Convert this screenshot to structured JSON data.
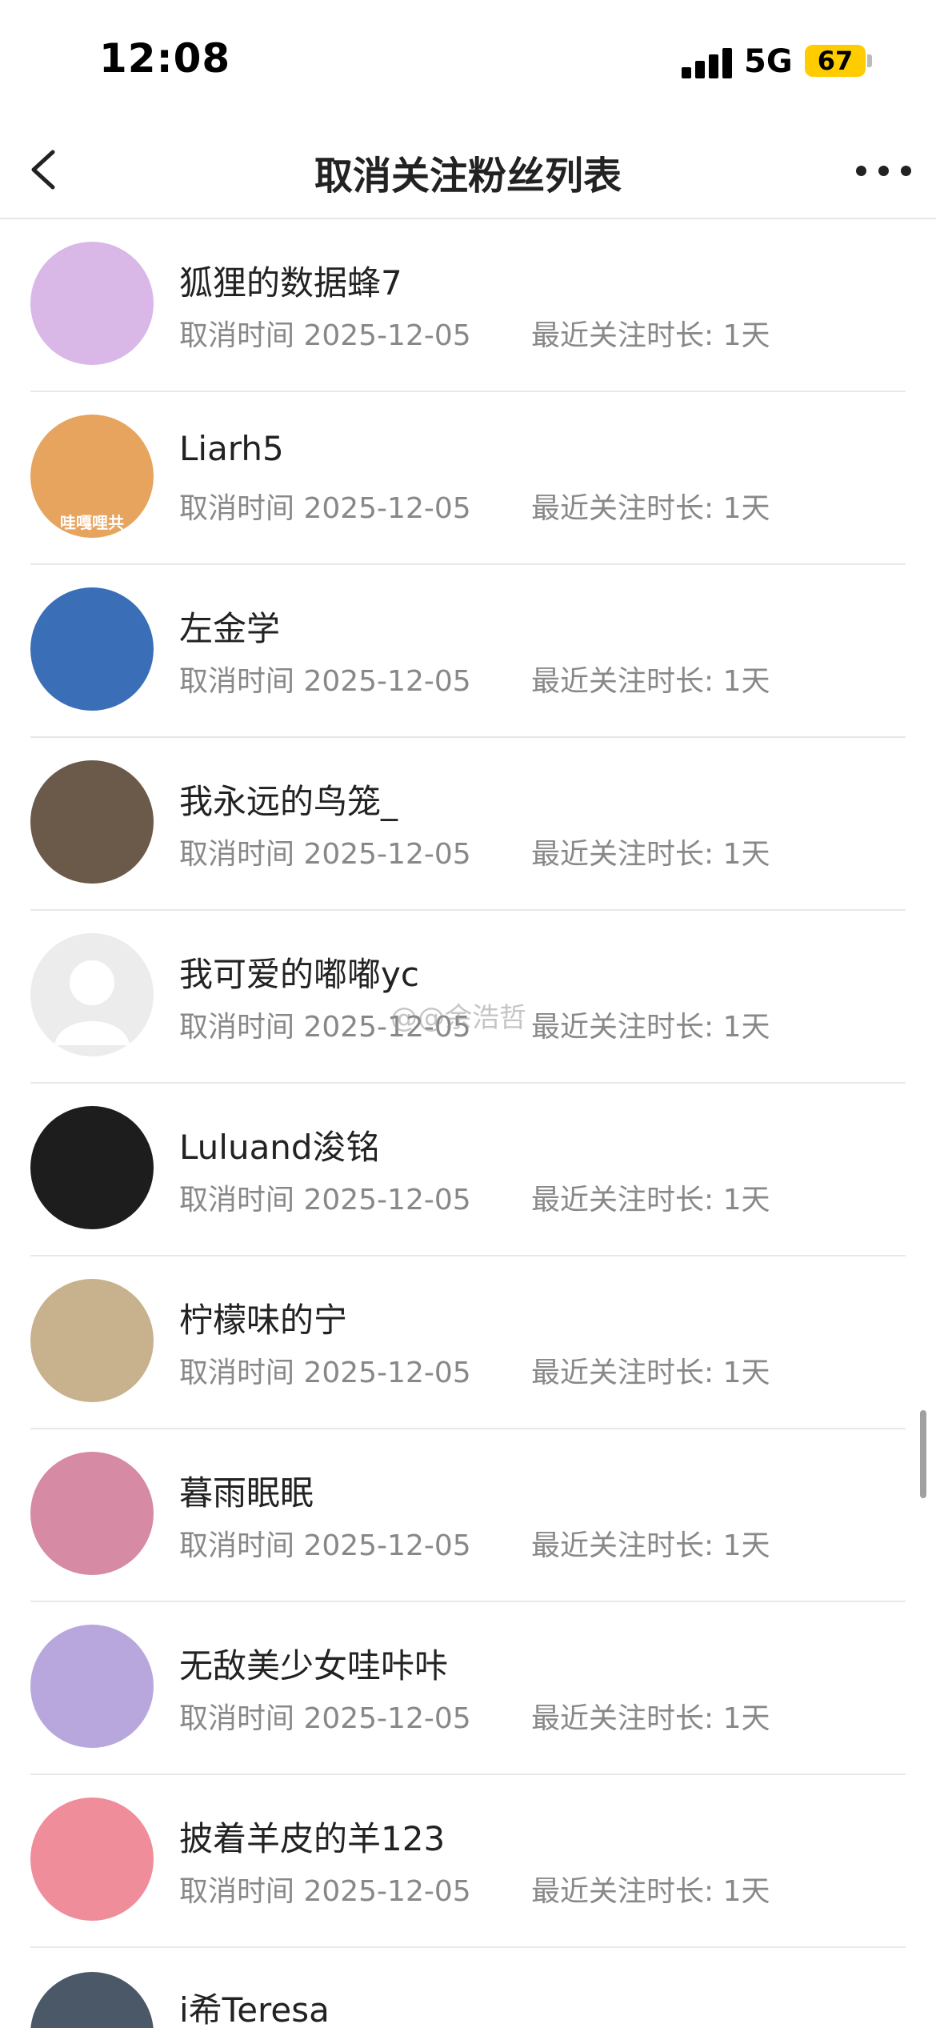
{
  "status_bar": {
    "time": "12:08",
    "network": "5G",
    "battery": "67"
  },
  "nav": {
    "title": "取消关注粉丝列表",
    "back_icon": "chevron-left-icon",
    "more_icon": "more-dots-icon"
  },
  "list": {
    "items": [
      {
        "name": "狐狸的数据蜂7",
        "cancel_label": "取消时间 2025-12-05",
        "duration_label": "最近关注时长: 1天",
        "avatar_color": "#d9b8e8"
      },
      {
        "name": "Liarh5",
        "cancel_label": "取消时间 2025-12-05",
        "duration_label": "最近关注时长: 1天",
        "avatar_color": "#e6a45e",
        "avatar_label": "哇嘎哩共"
      },
      {
        "name": "左金学",
        "cancel_label": "取消时间 2025-12-05",
        "duration_label": "最近关注时长: 1天",
        "avatar_color": "#3a6fb8"
      },
      {
        "name": "我永远的鸟笼_",
        "cancel_label": "取消时间 2025-12-05",
        "duration_label": "最近关注时长: 1天",
        "avatar_color": "#6b5a4a"
      },
      {
        "name": "我可爱的嘟嘟yc",
        "cancel_label": "取消时间 2025-12-05",
        "duration_label": "最近关注时长: 1天",
        "avatar_color": "#ececec"
      },
      {
        "name": "Luluand浚铭",
        "cancel_label": "取消时间 2025-12-05",
        "duration_label": "最近关注时长: 1天",
        "avatar_color": "#1d1d1d"
      },
      {
        "name": "柠檬味的宁",
        "cancel_label": "取消时间 2025-12-05",
        "duration_label": "最近关注时长: 1天",
        "avatar_color": "#c8b18d"
      },
      {
        "name": "暮雨眠眠",
        "cancel_label": "取消时间 2025-12-05",
        "duration_label": "最近关注时长: 1天",
        "avatar_color": "#d68aa4"
      },
      {
        "name": "无敌美少女哇咔咔",
        "cancel_label": "取消时间 2025-12-05",
        "duration_label": "最近关注时长: 1天",
        "avatar_color": "#b8a7dd"
      },
      {
        "name": "披着羊皮的羊123",
        "cancel_label": "取消时间 2025-12-05",
        "duration_label": "最近关注时长: 1天",
        "avatar_color": "#f08d9a"
      }
    ],
    "partial_item": {
      "name": "i希Teresa",
      "avatar_color": "#4a5868"
    }
  },
  "watermark": "@@余浩哲"
}
